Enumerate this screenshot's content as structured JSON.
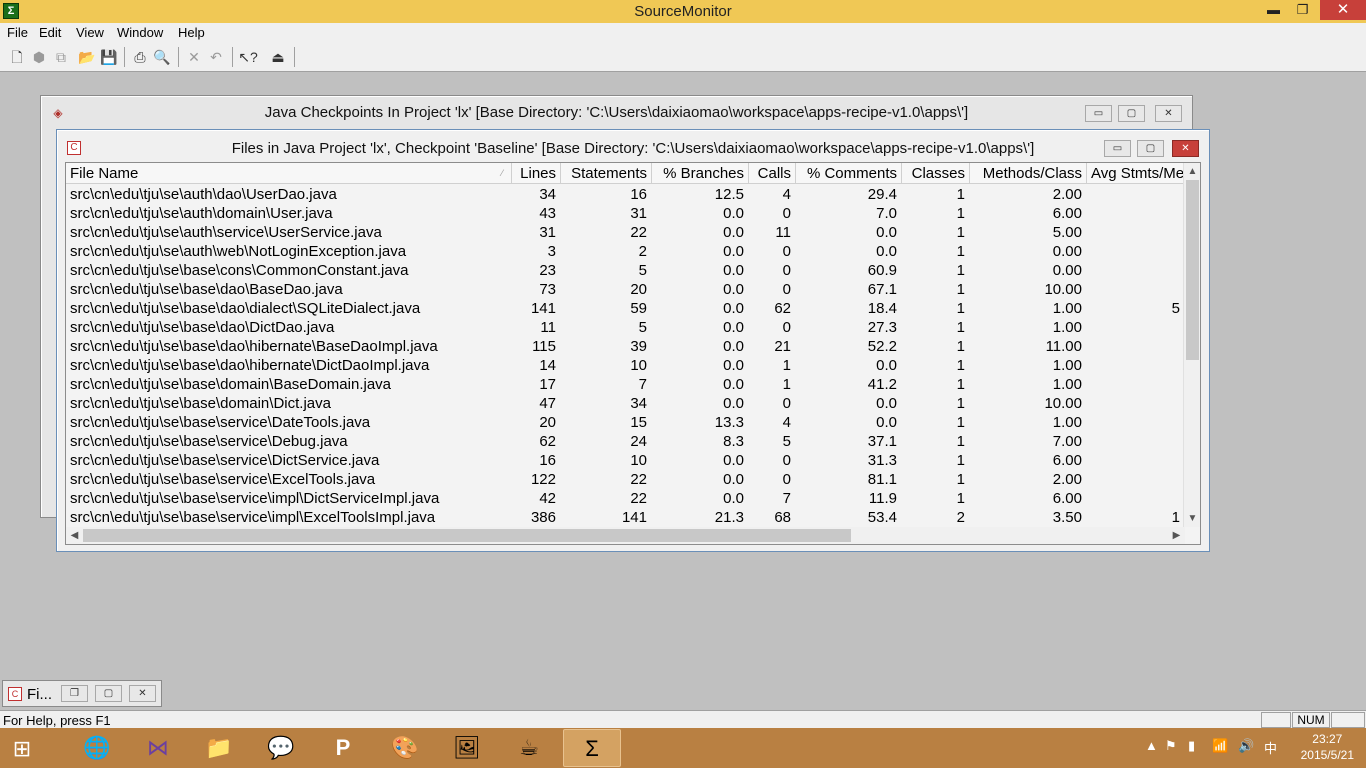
{
  "app": {
    "title": "SourceMonitor"
  },
  "menu": [
    "File",
    "Edit",
    "View",
    "Window",
    "Help"
  ],
  "back_window": {
    "title": "Java Checkpoints In Project 'lx'  [Base Directory: 'C:\\Users\\daixiaomao\\workspace\\apps-recipe-v1.0\\apps\\']"
  },
  "front_window": {
    "title": "Files in Java Project 'lx', Checkpoint 'Baseline'  [Base Directory: 'C:\\Users\\daixiaomao\\workspace\\apps-recipe-v1.0\\apps\\']",
    "columns": [
      "File Name",
      "Lines",
      "Statements",
      "% Branches",
      "Calls",
      "% Comments",
      "Classes",
      "Methods/Class",
      "Avg Stmts/Me"
    ],
    "rows": [
      {
        "file": "src\\cn\\edu\\tju\\se\\auth\\dao\\UserDao.java",
        "lines": "34",
        "statements": "16",
        "branches": "12.5",
        "calls": "4",
        "comments": "29.4",
        "classes": "1",
        "methods": "2.00",
        "avg": ""
      },
      {
        "file": "src\\cn\\edu\\tju\\se\\auth\\domain\\User.java",
        "lines": "43",
        "statements": "31",
        "branches": "0.0",
        "calls": "0",
        "comments": "7.0",
        "classes": "1",
        "methods": "6.00",
        "avg": ""
      },
      {
        "file": "src\\cn\\edu\\tju\\se\\auth\\service\\UserService.java",
        "lines": "31",
        "statements": "22",
        "branches": "0.0",
        "calls": "11",
        "comments": "0.0",
        "classes": "1",
        "methods": "5.00",
        "avg": ""
      },
      {
        "file": "src\\cn\\edu\\tju\\se\\auth\\web\\NotLoginException.java",
        "lines": "3",
        "statements": "2",
        "branches": "0.0",
        "calls": "0",
        "comments": "0.0",
        "classes": "1",
        "methods": "0.00",
        "avg": ""
      },
      {
        "file": "src\\cn\\edu\\tju\\se\\base\\cons\\CommonConstant.java",
        "lines": "23",
        "statements": "5",
        "branches": "0.0",
        "calls": "0",
        "comments": "60.9",
        "classes": "1",
        "methods": "0.00",
        "avg": ""
      },
      {
        "file": "src\\cn\\edu\\tju\\se\\base\\dao\\BaseDao.java",
        "lines": "73",
        "statements": "20",
        "branches": "0.0",
        "calls": "0",
        "comments": "67.1",
        "classes": "1",
        "methods": "10.00",
        "avg": ""
      },
      {
        "file": "src\\cn\\edu\\tju\\se\\base\\dao\\dialect\\SQLiteDialect.java",
        "lines": "141",
        "statements": "59",
        "branches": "0.0",
        "calls": "62",
        "comments": "18.4",
        "classes": "1",
        "methods": "1.00",
        "avg": "5"
      },
      {
        "file": "src\\cn\\edu\\tju\\se\\base\\dao\\DictDao.java",
        "lines": "11",
        "statements": "5",
        "branches": "0.0",
        "calls": "0",
        "comments": "27.3",
        "classes": "1",
        "methods": "1.00",
        "avg": ""
      },
      {
        "file": "src\\cn\\edu\\tju\\se\\base\\dao\\hibernate\\BaseDaoImpl.java",
        "lines": "115",
        "statements": "39",
        "branches": "0.0",
        "calls": "21",
        "comments": "52.2",
        "classes": "1",
        "methods": "11.00",
        "avg": ""
      },
      {
        "file": "src\\cn\\edu\\tju\\se\\base\\dao\\hibernate\\DictDaoImpl.java",
        "lines": "14",
        "statements": "10",
        "branches": "0.0",
        "calls": "1",
        "comments": "0.0",
        "classes": "1",
        "methods": "1.00",
        "avg": ""
      },
      {
        "file": "src\\cn\\edu\\tju\\se\\base\\domain\\BaseDomain.java",
        "lines": "17",
        "statements": "7",
        "branches": "0.0",
        "calls": "1",
        "comments": "41.2",
        "classes": "1",
        "methods": "1.00",
        "avg": ""
      },
      {
        "file": "src\\cn\\edu\\tju\\se\\base\\domain\\Dict.java",
        "lines": "47",
        "statements": "34",
        "branches": "0.0",
        "calls": "0",
        "comments": "0.0",
        "classes": "1",
        "methods": "10.00",
        "avg": ""
      },
      {
        "file": "src\\cn\\edu\\tju\\se\\base\\service\\DateTools.java",
        "lines": "20",
        "statements": "15",
        "branches": "13.3",
        "calls": "4",
        "comments": "0.0",
        "classes": "1",
        "methods": "1.00",
        "avg": ""
      },
      {
        "file": "src\\cn\\edu\\tju\\se\\base\\service\\Debug.java",
        "lines": "62",
        "statements": "24",
        "branches": "8.3",
        "calls": "5",
        "comments": "37.1",
        "classes": "1",
        "methods": "7.00",
        "avg": ""
      },
      {
        "file": "src\\cn\\edu\\tju\\se\\base\\service\\DictService.java",
        "lines": "16",
        "statements": "10",
        "branches": "0.0",
        "calls": "0",
        "comments": "31.3",
        "classes": "1",
        "methods": "6.00",
        "avg": ""
      },
      {
        "file": "src\\cn\\edu\\tju\\se\\base\\service\\ExcelTools.java",
        "lines": "122",
        "statements": "22",
        "branches": "0.0",
        "calls": "0",
        "comments": "81.1",
        "classes": "1",
        "methods": "2.00",
        "avg": ""
      },
      {
        "file": "src\\cn\\edu\\tju\\se\\base\\service\\impl\\DictServiceImpl.java",
        "lines": "42",
        "statements": "22",
        "branches": "0.0",
        "calls": "7",
        "comments": "11.9",
        "classes": "1",
        "methods": "6.00",
        "avg": ""
      },
      {
        "file": "src\\cn\\edu\\tju\\se\\base\\service\\impl\\ExcelToolsImpl.java",
        "lines": "386",
        "statements": "141",
        "branches": "21.3",
        "calls": "68",
        "comments": "53.4",
        "classes": "2",
        "methods": "3.50",
        "avg": "1"
      }
    ]
  },
  "minimized_window": {
    "label": "Fi..."
  },
  "status": {
    "help_text": "For Help, press F1",
    "num_indicator": "NUM"
  },
  "taskbar": {
    "time": "23:27",
    "date": "2015/5/21",
    "ime": "中"
  },
  "colors": {
    "titlebar": "#f0c855",
    "taskbar": "#b98042",
    "close": "#c7403a",
    "mdi_background": "#c0c0c0"
  }
}
